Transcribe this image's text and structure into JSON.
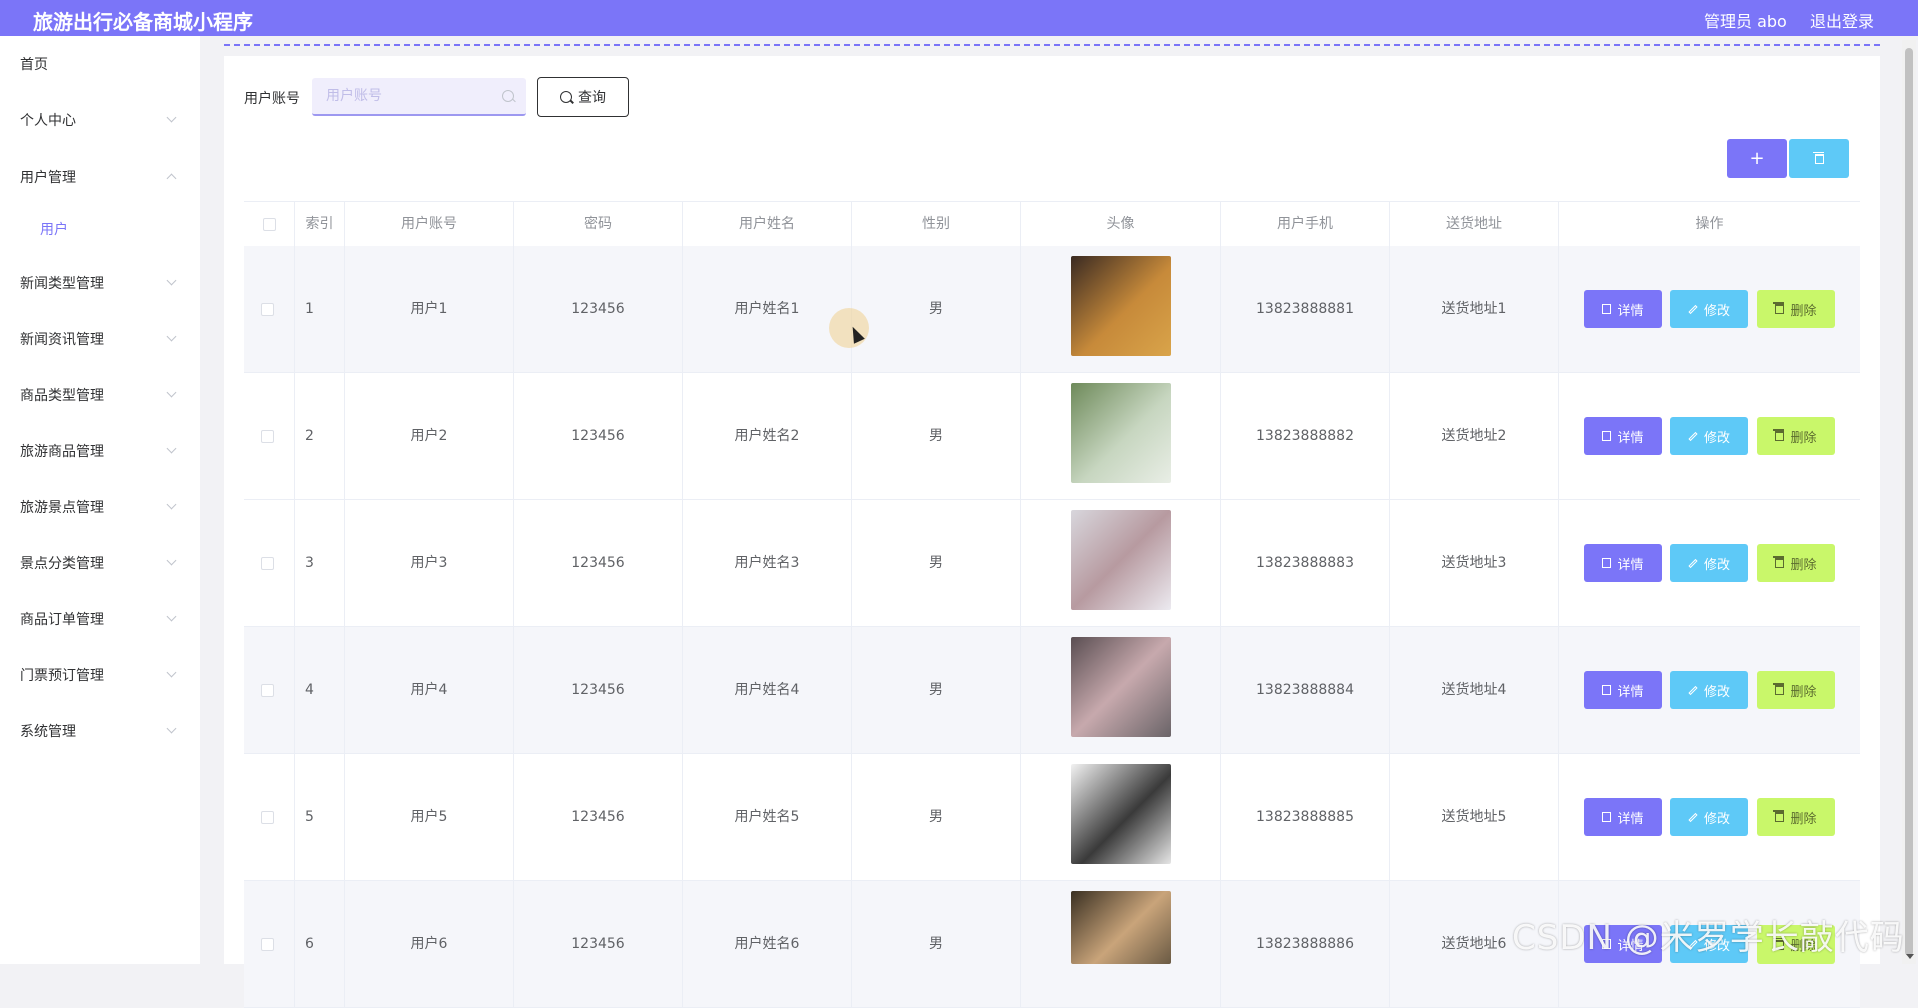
{
  "header": {
    "title": "旅游出行必备商城小程序",
    "user": "管理员 abo",
    "logout": "退出登录"
  },
  "sidebar": {
    "items": [
      {
        "label": "首页",
        "chevron": "none"
      },
      {
        "label": "个人中心",
        "chevron": "down"
      },
      {
        "label": "用户管理",
        "chevron": "up"
      },
      {
        "label": "用户",
        "chevron": "none",
        "sub": true
      },
      {
        "label": "新闻类型管理",
        "chevron": "down"
      },
      {
        "label": "新闻资讯管理",
        "chevron": "down"
      },
      {
        "label": "商品类型管理",
        "chevron": "down"
      },
      {
        "label": "旅游商品管理",
        "chevron": "down"
      },
      {
        "label": "旅游景点管理",
        "chevron": "down"
      },
      {
        "label": "景点分类管理",
        "chevron": "down"
      },
      {
        "label": "商品订单管理",
        "chevron": "down"
      },
      {
        "label": "门票预订管理",
        "chevron": "down"
      },
      {
        "label": "系统管理",
        "chevron": "down"
      }
    ]
  },
  "search": {
    "label": "用户账号",
    "placeholder": "用户账号",
    "value": "",
    "button": "查询"
  },
  "toolbar": {
    "add_symbol": "+"
  },
  "table": {
    "columns": [
      "索引",
      "用户账号",
      "密码",
      "用户姓名",
      "性别",
      "头像",
      "用户手机",
      "送货地址",
      "操作"
    ],
    "actions": {
      "detail": "详情",
      "edit": "修改",
      "delete": "删除"
    },
    "rows": [
      {
        "index": "1",
        "account": "用户1",
        "password": "123456",
        "name": "用户姓名1",
        "gender": "男",
        "phone": "13823888881",
        "address": "送货地址1"
      },
      {
        "index": "2",
        "account": "用户2",
        "password": "123456",
        "name": "用户姓名2",
        "gender": "男",
        "phone": "13823888882",
        "address": "送货地址2"
      },
      {
        "index": "3",
        "account": "用户3",
        "password": "123456",
        "name": "用户姓名3",
        "gender": "男",
        "phone": "13823888883",
        "address": "送货地址3"
      },
      {
        "index": "4",
        "account": "用户4",
        "password": "123456",
        "name": "用户姓名4",
        "gender": "男",
        "phone": "13823888884",
        "address": "送货地址4"
      },
      {
        "index": "5",
        "account": "用户5",
        "password": "123456",
        "name": "用户姓名5",
        "gender": "男",
        "phone": "13823888885",
        "address": "送货地址5"
      },
      {
        "index": "6",
        "account": "用户6",
        "password": "123456",
        "name": "用户姓名6",
        "gender": "男",
        "phone": "13823888886",
        "address": "送货地址6"
      }
    ]
  },
  "watermark": "CSDN @米罗学长敲代码",
  "colors": {
    "primary": "#7b75f8",
    "info": "#5ec9f7",
    "success": "#c9f76a"
  }
}
